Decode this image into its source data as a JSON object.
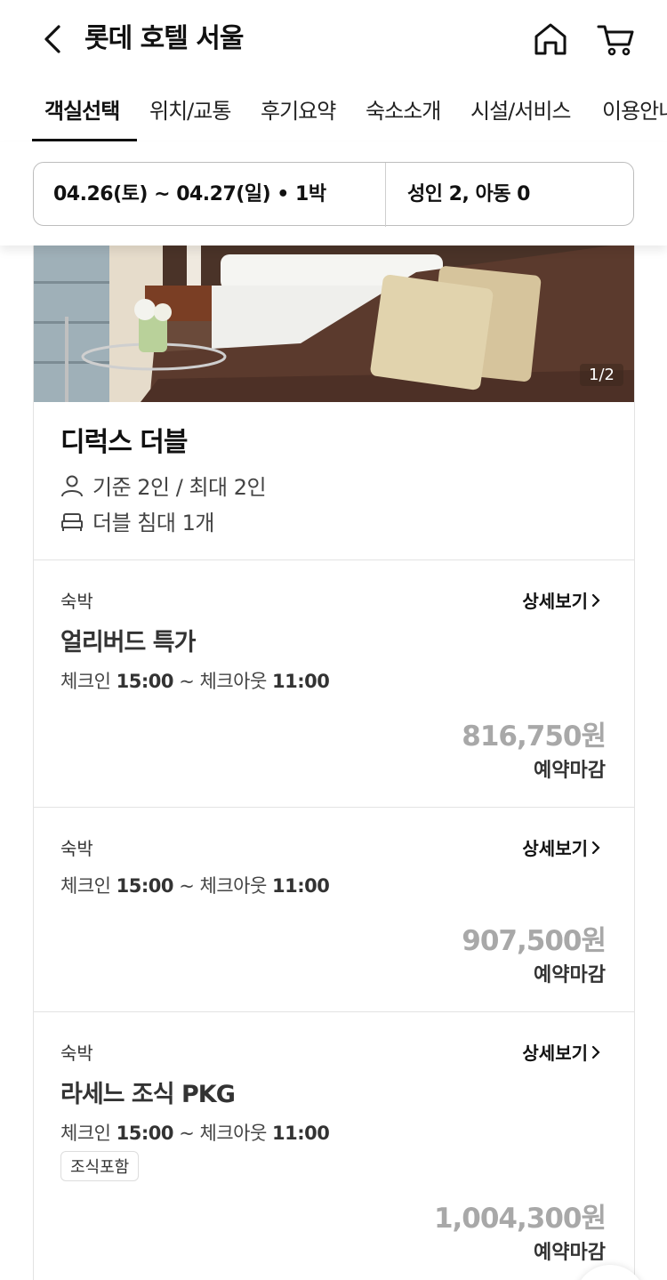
{
  "header": {
    "title": "롯데 호텔 서울"
  },
  "tabs": [
    {
      "label": "객실선택"
    },
    {
      "label": "위치/교통"
    },
    {
      "label": "후기요약"
    },
    {
      "label": "숙소소개"
    },
    {
      "label": "시설/서비스"
    },
    {
      "label": "이용안내"
    }
  ],
  "selector": {
    "dates": "04.26(토) ~ 04.27(일) • 1박",
    "guests": "성인 2, 아동 0"
  },
  "room": {
    "photo_counter": "1/2",
    "name": "디럭스 더블",
    "capacity": "기준 2인 / 최대 2인",
    "bed": "더블 침대 1개"
  },
  "plans": [
    {
      "type": "숙박",
      "detail_label": "상세보기",
      "name": "얼리버드 특가",
      "checkin_label": "체크인",
      "checkin_time": "15:00",
      "separator": "~",
      "checkout_label": "체크아웃",
      "checkout_time": "11:00",
      "price": "816,750원",
      "status": "예약마감"
    },
    {
      "type": "숙박",
      "detail_label": "상세보기",
      "checkin_label": "체크인",
      "checkin_time": "15:00",
      "separator": "~",
      "checkout_label": "체크아웃",
      "checkout_time": "11:00",
      "price": "907,500원",
      "status": "예약마감"
    },
    {
      "type": "숙박",
      "detail_label": "상세보기",
      "name": "라세느 조식 PKG",
      "checkin_label": "체크인",
      "checkin_time": "15:00",
      "separator": "~",
      "checkout_label": "체크아웃",
      "checkout_time": "11:00",
      "tag": "조식포함",
      "price": "1,004,300원",
      "status": "예약마감"
    }
  ]
}
